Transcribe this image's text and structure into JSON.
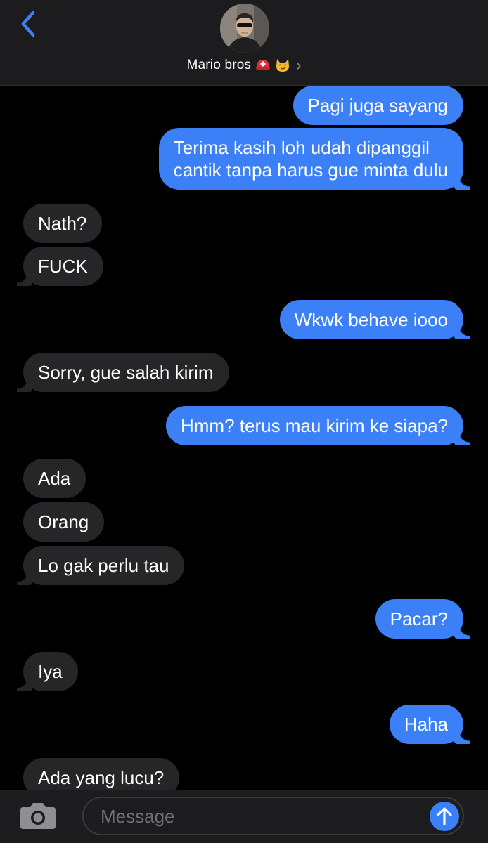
{
  "header": {
    "contact_name": "Mario bros",
    "emoji_1": "⛑️",
    "emoji_2": "😼"
  },
  "messages": [
    {
      "from": "me",
      "text": "Pagi juga sayang"
    },
    {
      "from": "me",
      "text": "Terima kasih loh udah dipanggil\ncantik tanpa harus gue minta dulu"
    },
    {
      "from": "them",
      "text": "Nath?"
    },
    {
      "from": "them",
      "text": "FUCK"
    },
    {
      "from": "me",
      "text": "Wkwk behave iooo"
    },
    {
      "from": "them",
      "text": "Sorry, gue salah kirim"
    },
    {
      "from": "me",
      "text": "Hmm? terus mau kirim ke siapa?"
    },
    {
      "from": "them",
      "text": "Ada"
    },
    {
      "from": "them",
      "text": "Orang"
    },
    {
      "from": "them",
      "text": "Lo gak perlu tau"
    },
    {
      "from": "me",
      "text": "Pacar?"
    },
    {
      "from": "them",
      "text": "Iya"
    },
    {
      "from": "me",
      "text": "Haha"
    },
    {
      "from": "them",
      "text": "Ada yang lucu?"
    }
  ],
  "composer": {
    "placeholder": "Message"
  },
  "colors": {
    "outgoing": "#3b80f7",
    "incoming": "#262629",
    "accent": "#3b80f7"
  },
  "icons": {
    "back": "chevron-left-icon",
    "camera": "camera-icon",
    "send": "arrow-up-icon",
    "disclosure": "chevron-right-icon"
  }
}
